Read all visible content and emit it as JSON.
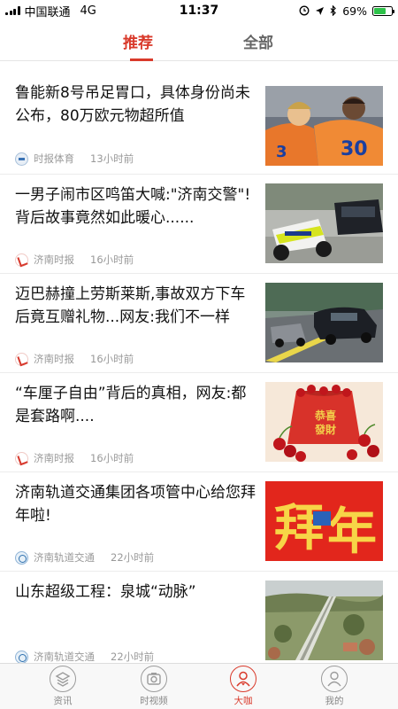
{
  "status_bar": {
    "carrier": "中国联通",
    "network": "4G",
    "time": "11:37",
    "battery": "69%",
    "battery_level": 0.69,
    "battery_color": "#2ec24a"
  },
  "top_tabs": [
    {
      "label": "推荐",
      "active": true
    },
    {
      "label": "全部",
      "active": false
    }
  ],
  "accent_color": "#d93a2b",
  "news": [
    {
      "title": "鲁能新8号吊足胃口，具体身份尚未公布，80万欧元物超所值",
      "source": "时报体育",
      "time": "13小时前",
      "source_icon": "sports-news-logo-icon",
      "thumb": "football-players-image"
    },
    {
      "title": "一男子闹市区鸣笛大喊:\"济南交警\"!背后故事竟然如此暖心......",
      "source": "济南时报",
      "time": "16小时前",
      "source_icon": "jinan-times-logo-icon",
      "thumb": "police-motorcycle-image"
    },
    {
      "title": "迈巴赫撞上劳斯莱斯,事故双方下车后竟互赠礼物...网友:我们不一样",
      "source": "济南时报",
      "time": "16小时前",
      "source_icon": "jinan-times-logo-icon",
      "thumb": "luxury-cars-road-image"
    },
    {
      "title": "“车厘子自由”背后的真相，网友:都是套路啊....",
      "source": "济南时报",
      "time": "16小时前",
      "source_icon": "jinan-times-logo-icon",
      "thumb": "cherries-gift-bag-image"
    },
    {
      "title": "济南轨道交通集团各项管中心给您拜年啦!",
      "source": "济南轨道交通",
      "time": "22小时前",
      "source_icon": "jinan-rail-transit-logo-icon",
      "thumb": "new-year-greeting-image"
    },
    {
      "title": "山东超级工程：泉城“动脉”",
      "source": "济南轨道交通",
      "time": "22小时前",
      "source_icon": "jinan-rail-transit-logo-icon",
      "thumb": "aerial-highway-image"
    }
  ],
  "thumb_texts": {
    "jersey_number": "30",
    "bag_text_1": "恭喜",
    "bag_text_2": "發財",
    "greeting_1": "拜",
    "greeting_2": "年"
  },
  "bottom_nav": [
    {
      "label": "资讯",
      "icon": "news-feed-icon",
      "active": false
    },
    {
      "label": "时视频",
      "icon": "video-camera-icon",
      "active": false
    },
    {
      "label": "大咖",
      "icon": "vip-person-icon",
      "active": true
    },
    {
      "label": "我的",
      "icon": "profile-icon",
      "active": false
    }
  ]
}
